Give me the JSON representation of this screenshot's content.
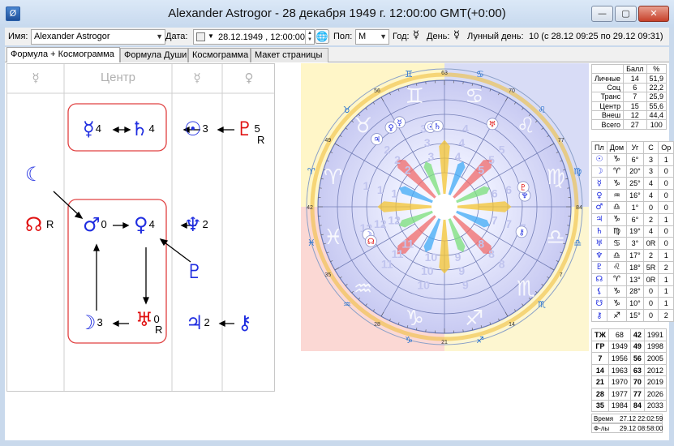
{
  "window": {
    "title": "Alexander Astrogor - 28 декабря 1949 г. 12:00:00 GMT(+0:00)",
    "app_icon": "Ø",
    "min_icon": "minimize-icon",
    "max_icon": "maximize-icon",
    "close_icon": "close-icon"
  },
  "toolbar": {
    "name_label": "Имя:",
    "name_value": "Alexander Astrogor",
    "date_label": "Дата:",
    "date_value": "28.12.1949 , 12:00:00",
    "gender_label": "Пол:",
    "gender_value": "М",
    "year_label": "Год:",
    "year_glyph": "☿",
    "day_label": "День:",
    "day_glyph": "☿",
    "lunar_label": "Лунный день:",
    "lunar_value": "10 (с 28.12 09:25 по 29.12 09:31)"
  },
  "tabs": [
    "Формула + Космограмма",
    "Формула Души",
    "Космограмма",
    "Макет страницы"
  ],
  "formula": {
    "headers": [
      "☿",
      "Центр",
      "☿",
      "♀"
    ],
    "glyphs": {
      "mercury": "☿",
      "mercury_n": "4",
      "saturn": "♄",
      "saturn_n": "4",
      "sun": "☉",
      "sun_n": "3",
      "pluto": "♇",
      "pluto_n": "5",
      "pluto_r": "R",
      "moon_top": "☾",
      "node": "☊",
      "node_r": "R",
      "mars": "♂",
      "mars_n": "0",
      "venus": "♀",
      "venus_n": "4",
      "neptune": "♆",
      "neptune_n": "2",
      "pluto2": "♇",
      "moon": "☽",
      "moon_n": "3",
      "uranus": "♅",
      "uranus_n": "0",
      "uranus_r": "R",
      "jupiter": "♃",
      "jupiter_n": "2",
      "chiron": "⚷"
    },
    "colors": {
      "blue": "#1f2de0",
      "red": "#e01010",
      "box": "#e04040"
    }
  },
  "cosmogram": {
    "outer_ticks": [
      "63",
      "70",
      "77",
      "84",
      "7",
      "14",
      "21",
      "28",
      "35",
      "42",
      "49",
      "56"
    ],
    "zodiac": [
      "♈",
      "♉",
      "♊",
      "♋",
      "♌",
      "♍",
      "♎",
      "♏",
      "♐",
      "♑",
      "♒",
      "♓"
    ],
    "house_numbers": [
      "1",
      "2",
      "3",
      "4",
      "5",
      "6",
      "7",
      "8",
      "9",
      "10",
      "11",
      "12"
    ],
    "planet_markers": [
      "☿",
      "☉",
      "♄",
      "♀",
      "♂",
      "♆",
      "♃",
      "☽",
      "♇",
      "♅",
      "☊",
      "⚷"
    ]
  },
  "scores": {
    "header": [
      "",
      "Балл",
      "%"
    ],
    "rows": [
      [
        "Личные",
        "14",
        "51,9"
      ],
      [
        "Соц",
        "6",
        "22,2"
      ],
      [
        "Транс",
        "7",
        "25,9"
      ],
      [
        "Центр",
        "15",
        "55,6"
      ],
      [
        "Внеш",
        "12",
        "44,4"
      ],
      [
        "Всего",
        "27",
        "100"
      ]
    ]
  },
  "planets": {
    "header": [
      "Пл",
      "Дом",
      "Уг",
      "С",
      "Ор"
    ],
    "rows": [
      [
        "☉",
        "♑",
        "6°",
        "3",
        "1"
      ],
      [
        "☽",
        "♈",
        "20°",
        "3",
        "0"
      ],
      [
        "☿",
        "♑",
        "25°",
        "4",
        "0"
      ],
      [
        "♀",
        "♒",
        "16°",
        "4",
        "0"
      ],
      [
        "♂",
        "♎",
        "1°",
        "0",
        "0"
      ],
      [
        "♃",
        "♑",
        "6°",
        "2",
        "1"
      ],
      [
        "♄",
        "♍",
        "19°",
        "4",
        "0"
      ],
      [
        "♅",
        "♋",
        "3°",
        "0R",
        "0"
      ],
      [
        "♆",
        "♎",
        "17°",
        "2",
        "1"
      ],
      [
        "♇",
        "♌",
        "18°",
        "5R",
        "2"
      ],
      [
        "☊",
        "♈",
        "13°",
        "0R",
        "1"
      ],
      [
        "⚸",
        "♑",
        "28°",
        "0",
        "1"
      ],
      [
        "☋",
        "♑",
        "10°",
        "0",
        "1"
      ],
      [
        "⚷",
        "♐",
        "15°",
        "0",
        "2"
      ]
    ]
  },
  "years": {
    "rows": [
      [
        "ТЖ",
        "68",
        "42",
        "1991"
      ],
      [
        "ГР",
        "1949",
        "49",
        "1998"
      ],
      [
        "7",
        "1956",
        "56",
        "2005"
      ],
      [
        "14",
        "1963",
        "63",
        "2012"
      ],
      [
        "21",
        "1970",
        "70",
        "2019"
      ],
      [
        "28",
        "1977",
        "77",
        "2026"
      ],
      [
        "35",
        "1984",
        "84",
        "2033"
      ]
    ]
  },
  "footer": {
    "time_label": "Время",
    "time_value": "27.12 22:02:59",
    "formula_label": "Ф-лы",
    "formula_value": "29.12 08:58:00"
  }
}
